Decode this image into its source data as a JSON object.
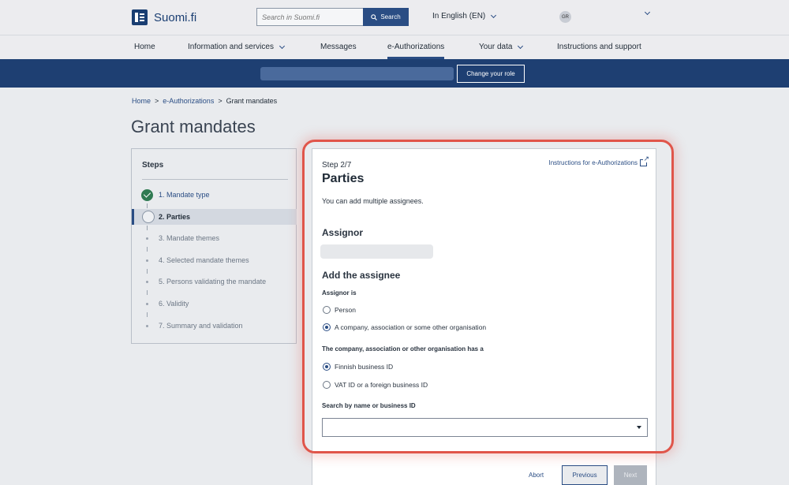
{
  "header": {
    "logo_text": "Suomi.fi",
    "search_placeholder": "Search in Suomi.fi",
    "search_button": "Search",
    "language": "In English (EN)",
    "user_initials": "GR"
  },
  "nav": {
    "items": [
      {
        "label": "Home"
      },
      {
        "label": "Information and services"
      },
      {
        "label": "Messages"
      },
      {
        "label": "e-Authorizations"
      },
      {
        "label": "Your data"
      },
      {
        "label": "Instructions and support"
      }
    ]
  },
  "rolebar": {
    "change_role": "Change your role"
  },
  "breadcrumb": {
    "home": "Home",
    "sep1": ">",
    "section": "e-Authorizations",
    "sep2": ">",
    "current": "Grant mandates"
  },
  "page": {
    "title": "Grant mandates"
  },
  "steps": {
    "title": "Steps",
    "items": [
      {
        "label": "1. Mandate type",
        "state": "done"
      },
      {
        "label": "2. Parties",
        "state": "current"
      },
      {
        "label": "3. Mandate themes",
        "state": "todo"
      },
      {
        "label": "4. Selected mandate themes",
        "state": "todo"
      },
      {
        "label": "5. Persons validating the mandate",
        "state": "todo"
      },
      {
        "label": "6. Validity",
        "state": "todo"
      },
      {
        "label": "7. Summary and validation",
        "state": "todo"
      }
    ]
  },
  "form": {
    "step": "Step 2/7",
    "instructions_link": "Instructions for e-Authorizations",
    "heading": "Parties",
    "intro": "You can add multiple assignees.",
    "assignor_heading": "Assignor",
    "assignee_heading": "Add the assignee",
    "assignor_is_label": "Assignor is",
    "assignor_options": [
      {
        "label": "Person",
        "selected": false
      },
      {
        "label": "A company, association or some other organisation",
        "selected": true
      }
    ],
    "org_id_label": "The company, association or other organisation has a",
    "org_id_options": [
      {
        "label": "Finnish business ID",
        "selected": true
      },
      {
        "label": "VAT ID or a foreign business ID",
        "selected": false
      }
    ],
    "search_label": "Search by name or business ID",
    "search_value": ""
  },
  "footer": {
    "abort": "Abort",
    "previous": "Previous",
    "next": "Next"
  },
  "colors": {
    "brand": "#1e3f72",
    "link": "#2a4d84",
    "highlight": "#e0554a",
    "success": "#2f7a52"
  }
}
